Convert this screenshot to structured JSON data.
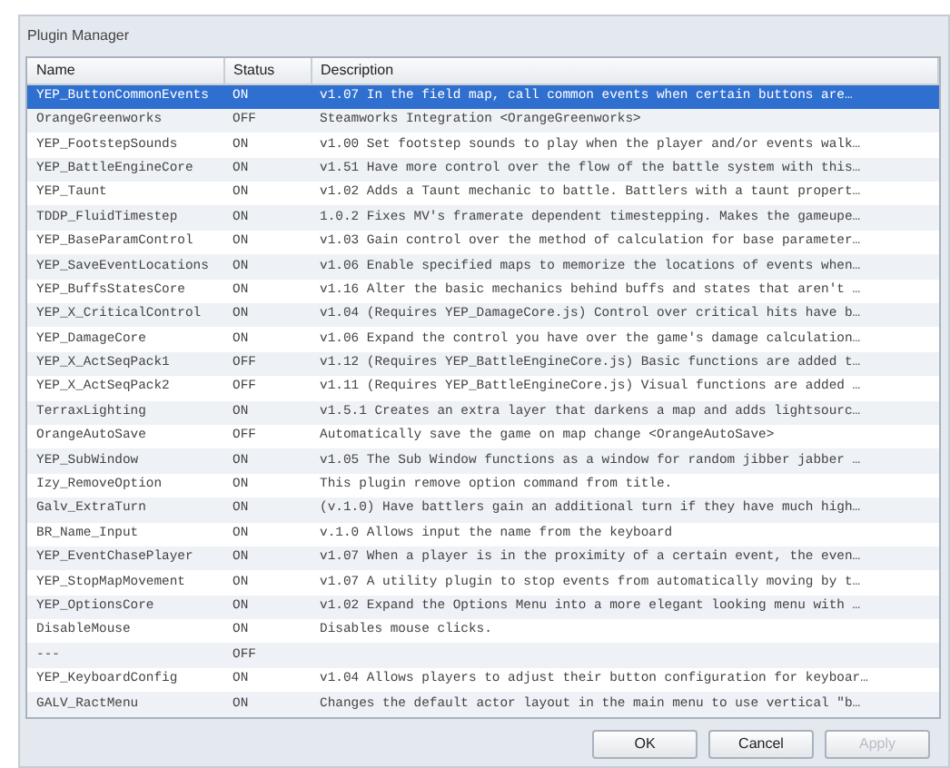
{
  "window": {
    "title": "Plugin Manager"
  },
  "table": {
    "columns": [
      "Name",
      "Status",
      "Description"
    ],
    "rows": [
      {
        "name": "YEP_ButtonCommonEvents",
        "status": "ON",
        "description": "v1.07 In the field map, call common events when certain buttons are…",
        "selected": true
      },
      {
        "name": "OrangeGreenworks",
        "status": "OFF",
        "description": "Steamworks Integration <OrangeGreenworks>",
        "selected": false
      },
      {
        "name": "YEP_FootstepSounds",
        "status": "ON",
        "description": "v1.00 Set footstep sounds to play when the player and/or events walk…",
        "selected": false
      },
      {
        "name": "YEP_BattleEngineCore",
        "status": "ON",
        "description": "v1.51 Have more control over the flow of the battle system with this…",
        "selected": false
      },
      {
        "name": "YEP_Taunt",
        "status": "ON",
        "description": "v1.02 Adds a Taunt mechanic to battle. Battlers with a taunt propert…",
        "selected": false
      },
      {
        "name": "TDDP_FluidTimestep",
        "status": "ON",
        "description": "1.0.2 Fixes MV's framerate dependent timestepping. Makes the gameupe…",
        "selected": false
      },
      {
        "name": "YEP_BaseParamControl",
        "status": "ON",
        "description": "v1.03 Gain control over the method of calculation for base parameter…",
        "selected": false
      },
      {
        "name": "YEP_SaveEventLocations",
        "status": "ON",
        "description": "v1.06 Enable specified maps to memorize the locations of events when…",
        "selected": false
      },
      {
        "name": "YEP_BuffsStatesCore",
        "status": "ON",
        "description": "v1.16 Alter the basic mechanics behind buffs and states that aren't …",
        "selected": false
      },
      {
        "name": "YEP_X_CriticalControl",
        "status": "ON",
        "description": "v1.04 (Requires YEP_DamageCore.js) Control over critical hits have b…",
        "selected": false
      },
      {
        "name": "YEP_DamageCore",
        "status": "ON",
        "description": "v1.06 Expand the control you have over the game's damage calculation…",
        "selected": false
      },
      {
        "name": "YEP_X_ActSeqPack1",
        "status": "OFF",
        "description": "v1.12 (Requires YEP_BattleEngineCore.js) Basic functions are added t…",
        "selected": false
      },
      {
        "name": "YEP_X_ActSeqPack2",
        "status": "OFF",
        "description": "v1.11 (Requires YEP_BattleEngineCore.js) Visual functions are added …",
        "selected": false
      },
      {
        "name": "TerraxLighting",
        "status": "ON",
        "description": "v1.5.1 Creates an extra layer that darkens a map and adds lightsourc…",
        "selected": false
      },
      {
        "name": "OrangeAutoSave",
        "status": "OFF",
        "description": "Automatically save the game on map change <OrangeAutoSave>",
        "selected": false
      },
      {
        "name": "YEP_SubWindow",
        "status": "ON",
        "description": "v1.05 The Sub Window functions as a window for random jibber jabber …",
        "selected": false
      },
      {
        "name": "Izy_RemoveOption",
        "status": "ON",
        "description": "This plugin remove option command from title.",
        "selected": false
      },
      {
        "name": "Galv_ExtraTurn",
        "status": "ON",
        "description": "(v.1.0) Have battlers gain an additional turn if they have much high…",
        "selected": false
      },
      {
        "name": "BR_Name_Input",
        "status": "ON",
        "description": "v.1.0 Allows input the name from the keyboard",
        "selected": false
      },
      {
        "name": "YEP_EventChasePlayer",
        "status": "ON",
        "description": "v1.07 When a player is in the proximity of a certain event, the even…",
        "selected": false
      },
      {
        "name": "YEP_StopMapMovement",
        "status": "ON",
        "description": "v1.07 A utility plugin to stop events from automatically moving by t…",
        "selected": false
      },
      {
        "name": "YEP_OptionsCore",
        "status": "ON",
        "description": "v1.02 Expand the Options Menu into a more elegant looking menu with …",
        "selected": false
      },
      {
        "name": "DisableMouse",
        "status": "ON",
        "description": "Disables mouse clicks.",
        "selected": false
      },
      {
        "name": "---",
        "status": "OFF",
        "selected": false
      },
      {
        "name": "YEP_KeyboardConfig",
        "status": "ON",
        "description": "v1.04 Allows players to adjust their button configuration for keyboar…",
        "selected": false
      },
      {
        "name": "GALV_RactMenu",
        "status": "ON",
        "description": "Changes the default actor layout in the main menu to use vertical \"b…",
        "selected": false
      }
    ]
  },
  "buttons": [
    {
      "label": "OK",
      "disabled": false
    },
    {
      "label": "Cancel",
      "disabled": false
    },
    {
      "label": "Apply",
      "disabled": true
    }
  ]
}
